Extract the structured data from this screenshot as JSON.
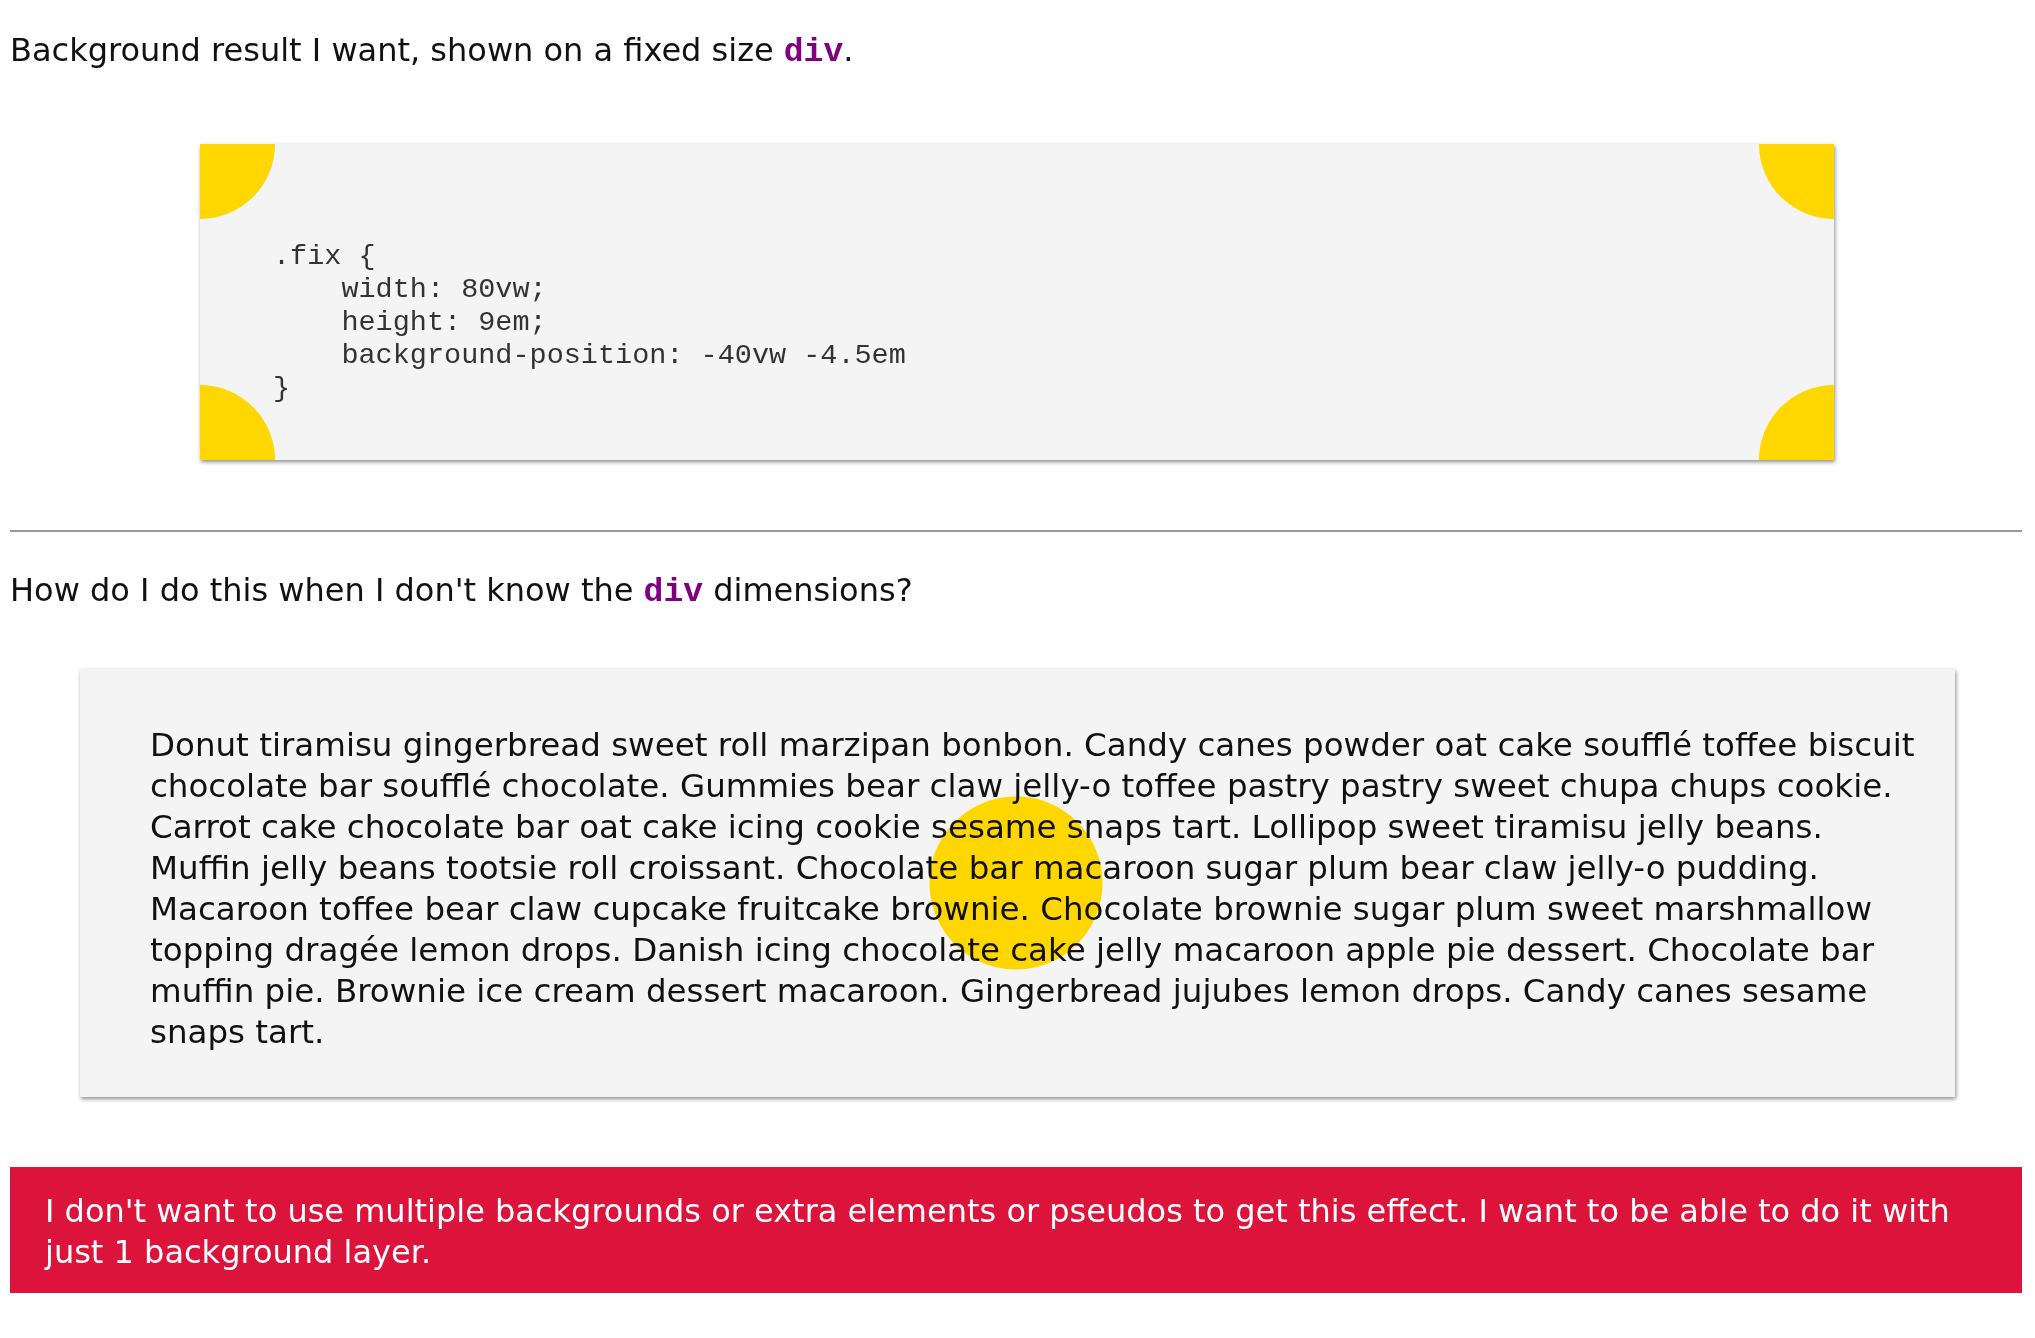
{
  "intro": {
    "before": "Background result I want, shown on a fixed size ",
    "code": "div",
    "after": "."
  },
  "code_example": {
    "lines": [
      ".fix {",
      "    width: 80vw;",
      "    height: 9em;",
      "    background-position: -40vw -4.5em",
      "}"
    ]
  },
  "question": {
    "before": "How do I do this when I don't know the ",
    "code": "div",
    "after": " dimensions?"
  },
  "sample_text": "Donut tiramisu gingerbread sweet roll marzipan bonbon. Candy canes powder oat cake soufflé toffee biscuit chocolate bar soufflé chocolate. Gummies bear claw jelly-o toffee pastry pastry sweet chupa chups cookie. Carrot cake chocolate bar oat cake icing cookie sesame snaps tart. Lollipop sweet tiramisu jelly beans. Muffin jelly beans tootsie roll croissant. Chocolate bar macaroon sugar plum bear claw jelly-o pudding. Macaroon toffee bear claw cupcake fruitcake brownie. Chocolate brownie sugar plum sweet marshmallow topping dragée lemon drops. Danish icing chocolate cake jelly macaroon apple pie dessert. Chocolate bar muffin pie. Brownie ice cream dessert macaroon. Gingerbread jujubes lemon drops. Candy canes sesame snaps tart.",
  "notice": "I don't want to use multiple backgrounds or extra elements or pseudos to get this effect. I want to be able to do it with just 1 background layer."
}
